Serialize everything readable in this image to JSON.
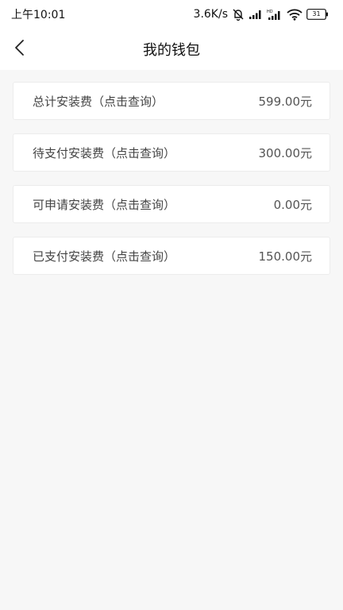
{
  "status_bar": {
    "time": "上午10:01",
    "net_speed": "3.6K/s",
    "battery": "31",
    "icons": [
      "mute-bell-icon",
      "signal-icon",
      "hd-signal-icon",
      "wifi-icon",
      "battery-icon"
    ]
  },
  "header": {
    "title": "我的钱包",
    "back_icon": "chevron-left-icon"
  },
  "items": [
    {
      "label": "总计安装费（点击查询）",
      "value": "599.00元"
    },
    {
      "label": "待支付安装费（点击查询）",
      "value": "300.00元"
    },
    {
      "label": "可申请安装费（点击查询）",
      "value": "0.00元"
    },
    {
      "label": "已支付安装费（点击查询）",
      "value": "150.00元"
    }
  ]
}
